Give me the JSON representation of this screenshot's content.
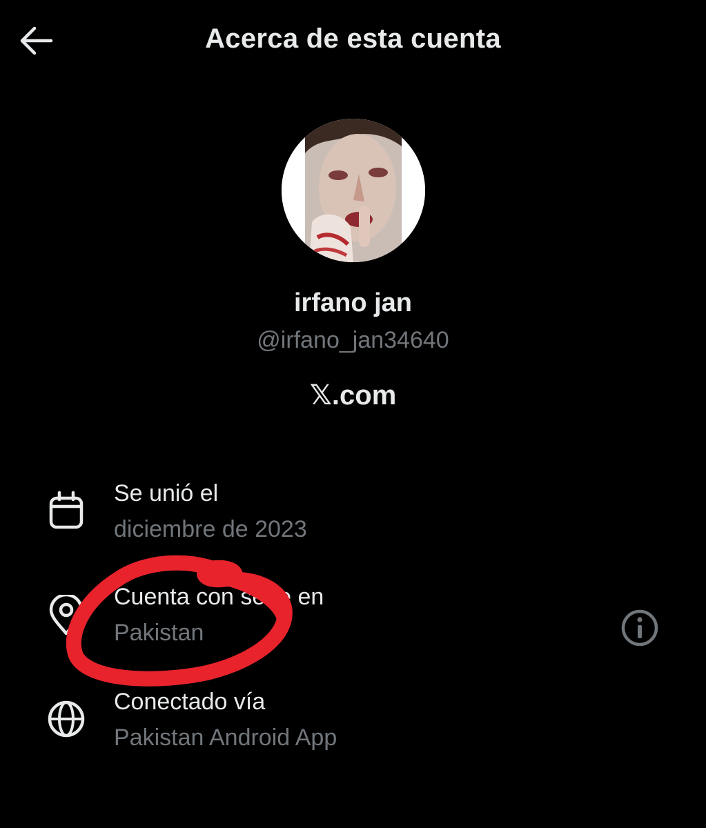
{
  "header": {
    "back_icon": "arrow-left-icon",
    "title": "Acerca de esta cuenta"
  },
  "profile": {
    "display_name": "irfano jan",
    "handle": "@irfano_jan34640",
    "site": "𝕏.com"
  },
  "details": [
    {
      "icon": "calendar-icon",
      "title": "Se unió el",
      "value": "diciembre de 2023"
    },
    {
      "icon": "location-pin-icon",
      "title": "Cuenta con sede en",
      "value": "Pakistan",
      "info_icon": "info-icon"
    },
    {
      "icon": "globe-icon",
      "title": "Conectado vía",
      "value": "Pakistan Android App"
    }
  ],
  "colors": {
    "background": "#000000",
    "primary_text": "#e7e9ea",
    "secondary_text": "#71767b",
    "annotation": "#e8232c"
  }
}
